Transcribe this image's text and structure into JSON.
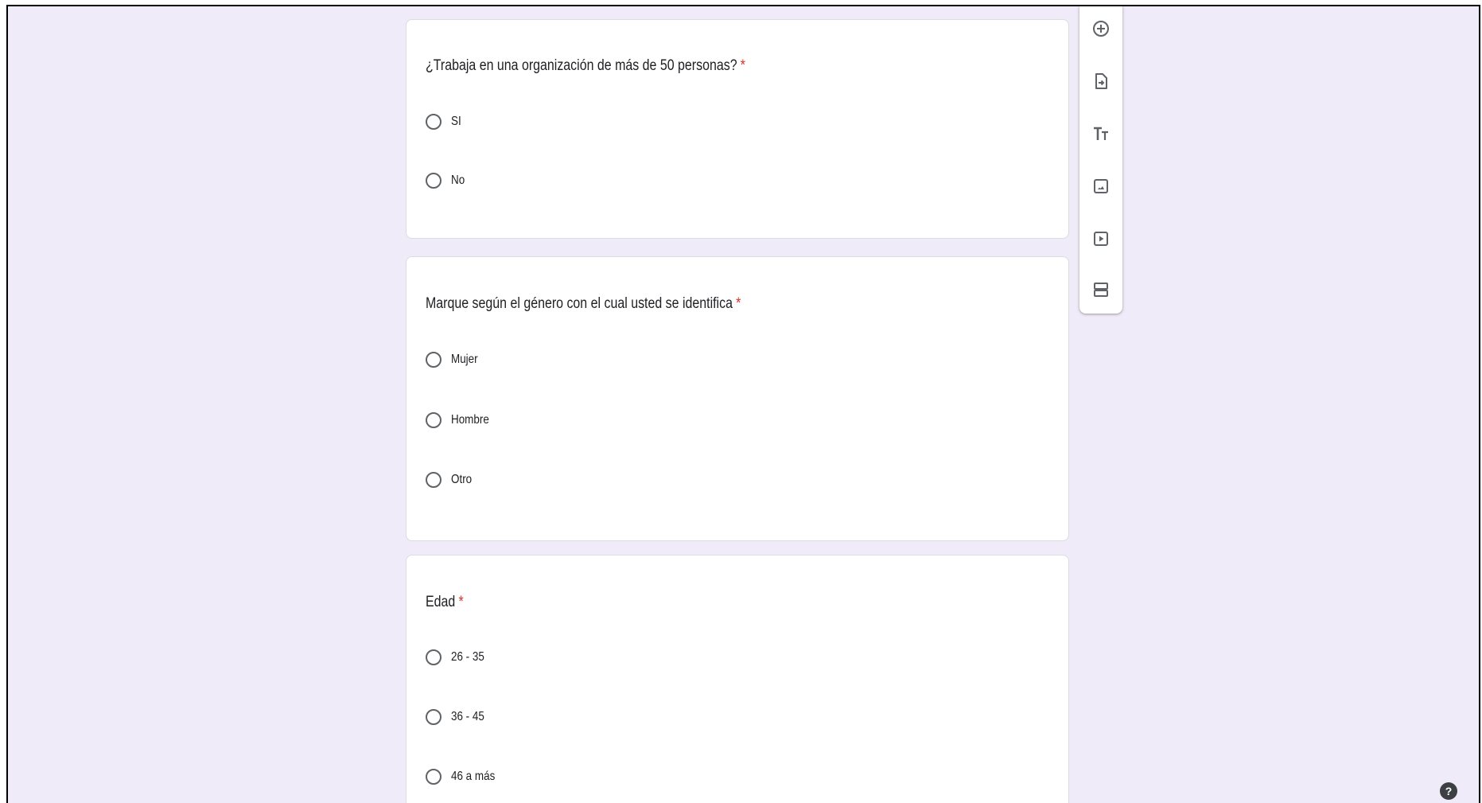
{
  "questions": [
    {
      "title": "¿Trabaja en una organización de más de 50 personas?",
      "required_mark": "*",
      "options": [
        "SI",
        "No"
      ]
    },
    {
      "title": "Marque según el género con el cual usted se identifica",
      "required_mark": "*",
      "options": [
        "Mujer",
        "Hombre",
        "Otro"
      ]
    },
    {
      "title": "Edad",
      "required_mark": "*",
      "options": [
        "26 - 35",
        "36 - 45",
        "46 a más"
      ]
    }
  ],
  "toolbar": {
    "icons": [
      "add-question-icon",
      "import-questions-icon",
      "add-title-icon",
      "add-image-icon",
      "add-video-icon",
      "add-section-icon"
    ]
  },
  "help": {
    "label": "?"
  },
  "colors": {
    "background": "#f0ebf8",
    "required": "#d93025",
    "icon": "#5f6368"
  }
}
